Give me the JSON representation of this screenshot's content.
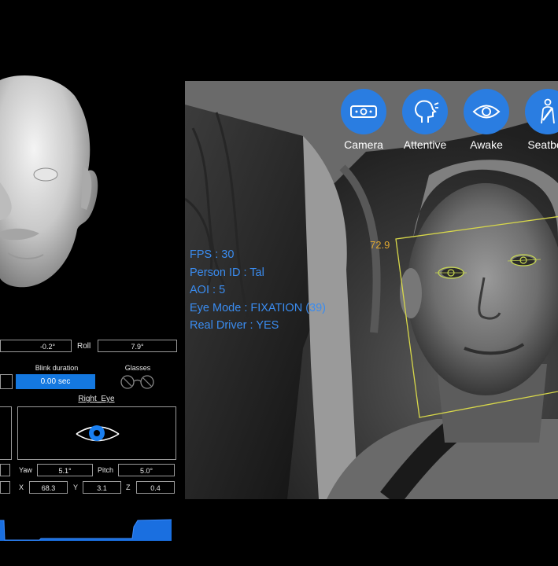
{
  "head_pose": {
    "yaw_partial": "-0.2°",
    "roll_label": "Roll",
    "roll_value": "7.9°"
  },
  "blink": {
    "label": "Blink duration",
    "value": "0.00 sec"
  },
  "glasses": {
    "label": "Glasses"
  },
  "right_eye": {
    "title": "Right_Eye",
    "yaw_label": "Yaw",
    "yaw_value": "5.1°",
    "pitch_label": "Pitch",
    "pitch_value": "5.0°",
    "x_label": "X",
    "x_value": "68.3",
    "y_label": "Y",
    "y_value": "3.1",
    "z_label": "Z",
    "z_value": "0.4"
  },
  "overlay": {
    "fps": "FPS : 30",
    "person_id": "Person ID : Tal",
    "aoi": "AOI : 5",
    "eye_mode": "Eye Mode : FIXATION (39)",
    "real_driver": "Real Driver : YES"
  },
  "face_box": {
    "score": "72.9"
  },
  "status_buttons": [
    {
      "label": "Camera",
      "icon": "camera-icon"
    },
    {
      "label": "Attentive",
      "icon": "attentive-head-icon"
    },
    {
      "label": "Awake",
      "icon": "eye-icon"
    },
    {
      "label": "Seatbelt",
      "icon": "seatbelt-icon"
    }
  ],
  "colors": {
    "accent_blue": "#2a7de1",
    "overlay_text": "#3a8cf0",
    "face_box": "#d8d84a",
    "score": "#e0a830"
  }
}
